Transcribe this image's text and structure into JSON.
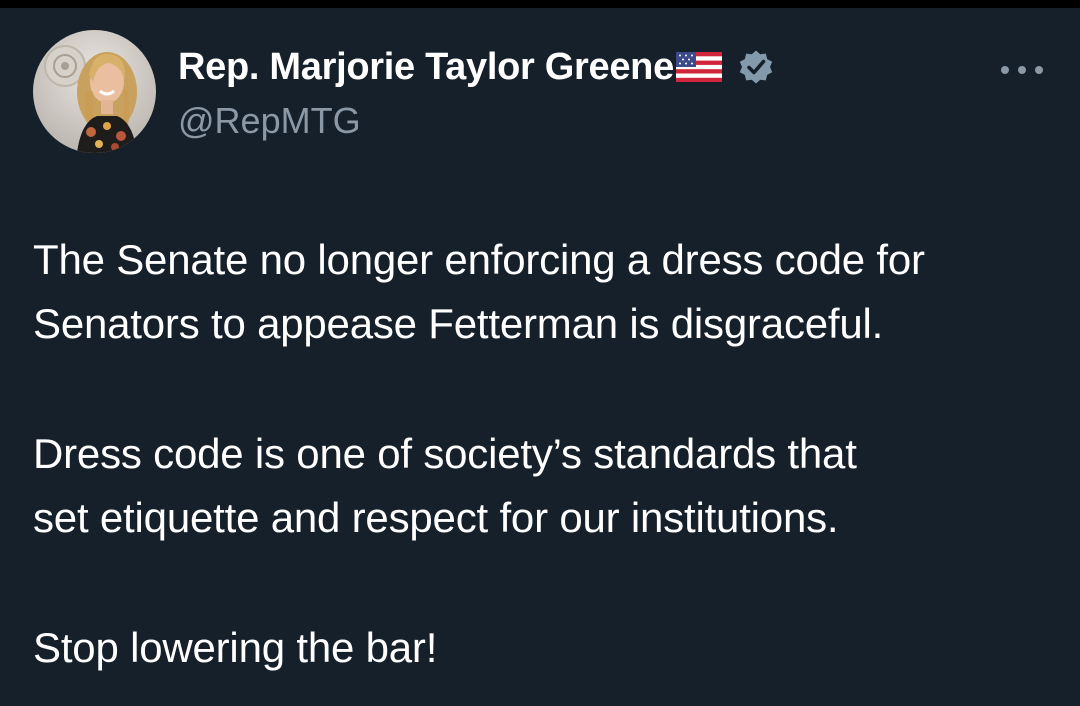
{
  "author": {
    "display_name": "Rep. Marjorie Taylor Greene",
    "handle": "@RepMTG",
    "flag_icon": "us-flag-icon",
    "verified_icon": "verified-badge-icon",
    "avatar_icon": "avatar-photo"
  },
  "menu": {
    "icon": "more-options-icon"
  },
  "tweet": {
    "paragraphs": [
      {
        "lines": [
          "The Senate no longer enforcing a dress code for",
          "Senators to appease Fetterman is disgraceful."
        ]
      },
      {
        "lines": [
          "Dress code is one of society’s standards that",
          "set etiquette and respect for our institutions."
        ]
      },
      {
        "lines": [
          "Stop lowering the bar!"
        ]
      }
    ]
  },
  "colors": {
    "background": "#15202b",
    "text_primary": "#ffffff",
    "text_secondary": "#8b98a5",
    "verified_badge": "#829aab"
  }
}
